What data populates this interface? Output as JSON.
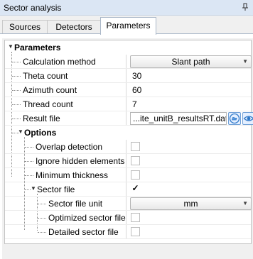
{
  "window": {
    "title": "Sector analysis"
  },
  "tabs": [
    {
      "label": "Sources"
    },
    {
      "label": "Detectors"
    },
    {
      "label": "Parameters"
    }
  ],
  "parameters": {
    "label": "Parameters",
    "calculation_method": {
      "label": "Calculation method",
      "value": "Slant path"
    },
    "theta_count": {
      "label": "Theta count",
      "value": "30"
    },
    "azimuth_count": {
      "label": "Azimuth count",
      "value": "60"
    },
    "thread_count": {
      "label": "Thread count",
      "value": "7"
    },
    "result_file": {
      "label": "Result file",
      "value": "...ite_unitB_resultsRT.dat"
    }
  },
  "options": {
    "label": "Options",
    "overlap_detection": {
      "label": "Overlap detection",
      "checked": false
    },
    "ignore_hidden": {
      "label": "Ignore hidden elements",
      "checked": false
    },
    "minimum_thickness": {
      "label": "Minimum thickness",
      "checked": false
    },
    "sector_file": {
      "label": "Sector file",
      "checked": true,
      "check_glyph": "✓"
    },
    "sector_file_unit": {
      "label": "Sector file unit",
      "value": "mm"
    },
    "optimized_sector_file": {
      "label": "Optimized sector file",
      "checked": false
    },
    "detailed_sector_file": {
      "label": "Detailed sector file",
      "checked": false
    }
  },
  "icons": {
    "pin": "pin-icon",
    "browse": "folder-open-icon",
    "view": "eye-icon",
    "dropdown": "chevron-down-icon"
  },
  "colors": {
    "titlebar": "#dbe6f4",
    "accent": "#2f78c8"
  }
}
